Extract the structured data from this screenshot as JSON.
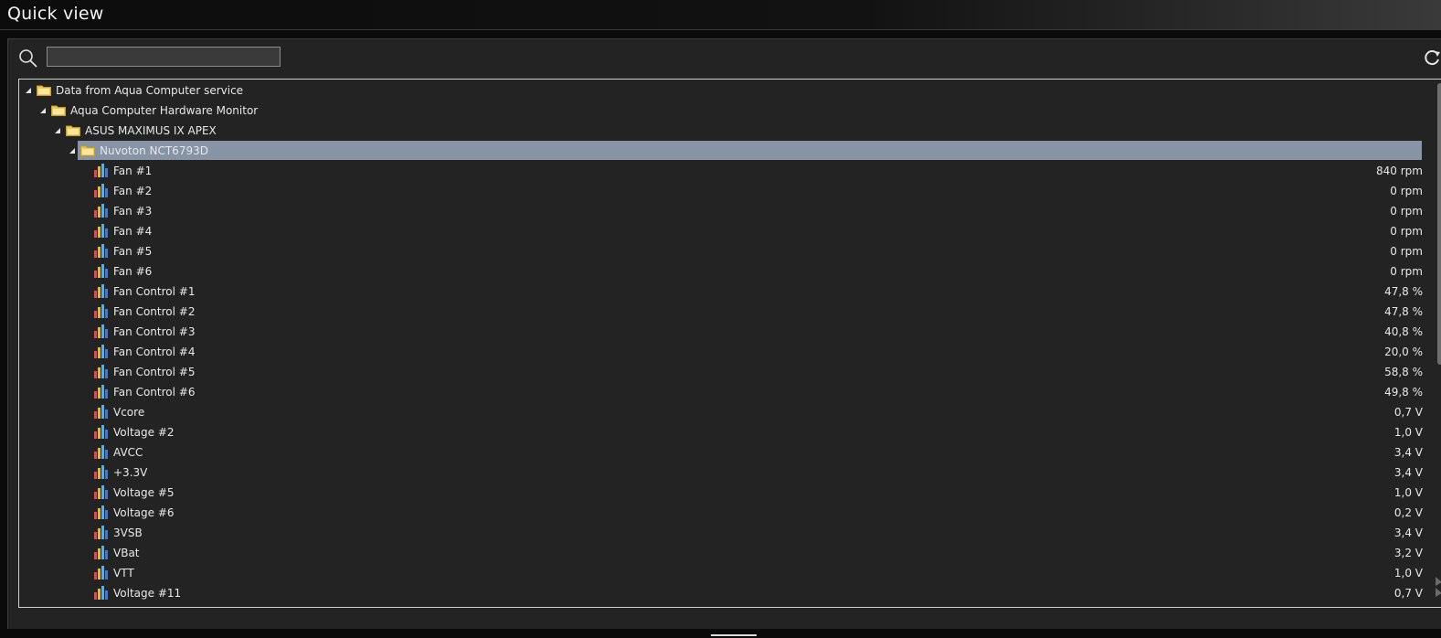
{
  "window": {
    "title": "Quick view"
  },
  "search": {
    "placeholder": "",
    "value": ""
  },
  "tree": {
    "root": "Data from Aqua Computer service",
    "service": "Aqua Computer Hardware Monitor",
    "board": "ASUS MAXIMUS IX APEX",
    "chip": "Nuvoton NCT6793D",
    "sensors": [
      {
        "name": "Fan #1",
        "value": "840 rpm"
      },
      {
        "name": "Fan #2",
        "value": "0 rpm"
      },
      {
        "name": "Fan #3",
        "value": "0 rpm"
      },
      {
        "name": "Fan #4",
        "value": "0 rpm"
      },
      {
        "name": "Fan #5",
        "value": "0 rpm"
      },
      {
        "name": "Fan #6",
        "value": "0 rpm"
      },
      {
        "name": "Fan Control #1",
        "value": "47,8 %"
      },
      {
        "name": "Fan Control #2",
        "value": "47,8 %"
      },
      {
        "name": "Fan Control #3",
        "value": "40,8 %"
      },
      {
        "name": "Fan Control #4",
        "value": "20,0 %"
      },
      {
        "name": "Fan Control #5",
        "value": "58,8 %"
      },
      {
        "name": "Fan Control #6",
        "value": "49,8 %"
      },
      {
        "name": "Vcore",
        "value": "0,7 V"
      },
      {
        "name": "Voltage #2",
        "value": "1,0 V"
      },
      {
        "name": "AVCC",
        "value": "3,4 V"
      },
      {
        "name": "+3.3V",
        "value": "3,4 V"
      },
      {
        "name": "Voltage #5",
        "value": "1,0 V"
      },
      {
        "name": "Voltage #6",
        "value": "0,2 V"
      },
      {
        "name": "3VSB",
        "value": "3,4 V"
      },
      {
        "name": "VBat",
        "value": "3,2 V"
      },
      {
        "name": "VTT",
        "value": "1,0 V"
      },
      {
        "name": "Voltage #11",
        "value": "0,7 V"
      }
    ]
  },
  "colors": {
    "selection": "#8694a6",
    "panel": "#232323",
    "folder": "#f1c84b"
  },
  "icons": {
    "search": "search-icon",
    "refresh": "refresh-icon",
    "folder": "folder-icon",
    "sensor": "bar-chart-icon"
  }
}
